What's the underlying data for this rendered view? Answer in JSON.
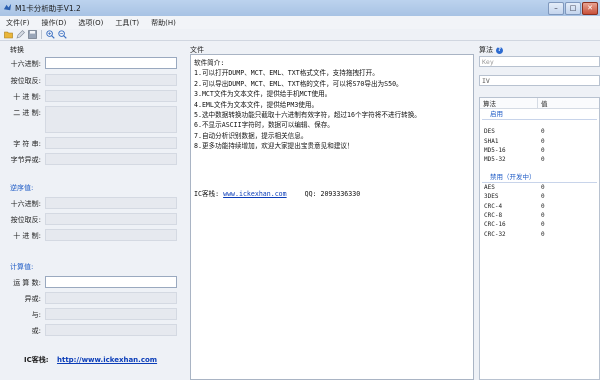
{
  "window": {
    "title": "M1卡分析助手V1.2",
    "controls": {
      "minimize": "–",
      "maximize": "□",
      "close": "✕"
    }
  },
  "menu": [
    "文件(F)",
    "操作(D)",
    "选项(O)",
    "工具(T)",
    "帮助(H)"
  ],
  "left": {
    "convert_title": "转换",
    "convert_fields": [
      {
        "label": "十六进制:"
      },
      {
        "label": "按位取反:"
      },
      {
        "label": "十 进 制:"
      },
      {
        "label": "二 进 制:"
      },
      {
        "label": "字 符 串:"
      },
      {
        "label": "字节异或:"
      }
    ],
    "reverse_title": "逆序值:",
    "reverse_fields": [
      {
        "label": "十六进制:"
      },
      {
        "label": "按位取反:"
      },
      {
        "label": "十 进 制:"
      }
    ],
    "calc_title": "计算值:",
    "calc_fields": [
      {
        "label": "运 算 数:"
      },
      {
        "label": "异或:"
      },
      {
        "label": "与:"
      },
      {
        "label": "或:"
      }
    ],
    "footer_label": "IC客栈:",
    "footer_link": "http://www.ickexhan.com"
  },
  "mid": {
    "title": "文件",
    "lines": [
      "软件简介:",
      "1.可以打开DUMP、MCT、EML、TXT格式文件，支持拖拽打开。",
      "2.可以导出DUMP、MCT、EML、TXT格的文件，可以将S70导出为S50。",
      "3.MCT文件为文本文件，提供给手机MCT使用。",
      "4.EML文件为文本文件，提供给PM3使用。",
      "5.选中数据转换功能只截取十六进制有效字符，超过16个字符将不进行转换。",
      "6.不显示ASCII字符时，数据可以编辑、保存。",
      "7.自动分析识别数据，提示相关信息。",
      "8.更多功能持续增加，欢迎大家提出宝贵意见和建议！"
    ],
    "footer_label": "IC客栈:",
    "footer_link": "www.ickexhan.com",
    "footer_qq": "QQ: 2093336330"
  },
  "right": {
    "title": "算法",
    "key_placeholder": "Key",
    "iv_value": "IV",
    "col_algo": "算法",
    "col_value": "值",
    "group_enabled": "启用",
    "enabled": [
      {
        "name": "DES",
        "value": "0"
      },
      {
        "name": "SHA1",
        "value": "0"
      },
      {
        "name": "MD5-16",
        "value": "0"
      },
      {
        "name": "MD5-32",
        "value": "0"
      }
    ],
    "group_disabled": "禁用（开发中）",
    "disabled": [
      {
        "name": "AES",
        "value": "0"
      },
      {
        "name": "3DES",
        "value": "0"
      },
      {
        "name": "CRC-4",
        "value": "0"
      },
      {
        "name": "CRC-8",
        "value": "0"
      },
      {
        "name": "CRC-16",
        "value": "0"
      },
      {
        "name": "CRC-32",
        "value": "0"
      }
    ]
  },
  "colors": {
    "accent": "#1e5bc6",
    "link": "#0b3db8",
    "panel_bg": "#eef1f6"
  },
  "icons": [
    "open-folder-icon",
    "pen-icon",
    "save-icon",
    "zoom-in-icon",
    "zoom-out-icon"
  ]
}
